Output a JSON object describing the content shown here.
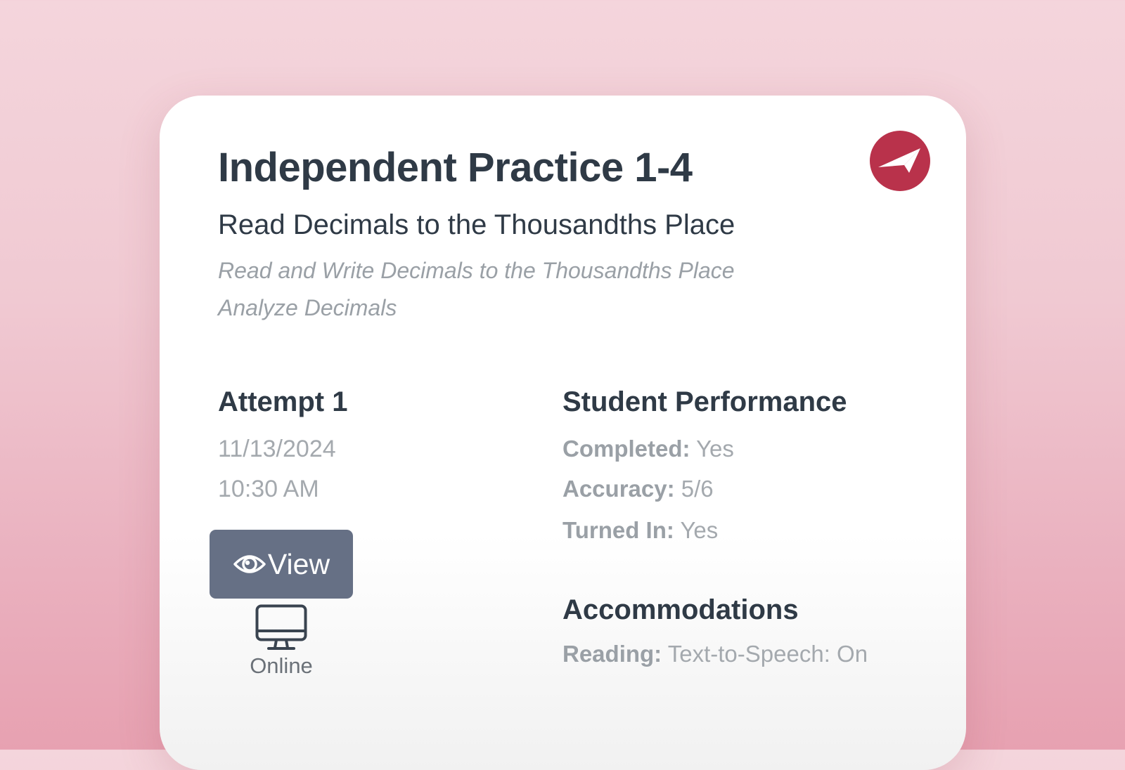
{
  "colors": {
    "background_top": "#f4d5dc",
    "background_bottom": "#e7a1b1",
    "card": "#ffffff",
    "heading_text": "#2f3a46",
    "muted_text": "#a4a9ae",
    "logo": "#b9324b",
    "button": "#667085"
  },
  "assignment": {
    "title": "Independent Practice 1-4",
    "lesson": "Read Decimals to the Thousandths Place",
    "standards": [
      "Read and Write Decimals to the Thousandths Place",
      "Analyze Decimals"
    ],
    "logo_icon": "paper-plane-icon"
  },
  "attempt": {
    "heading": "Attempt 1",
    "date": "11/13/2024",
    "time": "10:30 AM",
    "view_button": {
      "icon": "eye-icon",
      "label": "View"
    },
    "mode": {
      "icon": "monitor-icon",
      "label": "Online"
    }
  },
  "performance": {
    "heading": "Student Performance",
    "items": [
      {
        "label": "Completed:",
        "value": "Yes"
      },
      {
        "label": "Accuracy:",
        "value": "5/6"
      },
      {
        "label": "Turned In:",
        "value": "Yes"
      }
    ]
  },
  "accommodations": {
    "heading": "Accommodations",
    "items": [
      {
        "label": "Reading:",
        "value": "Text-to-Speech: On"
      }
    ]
  }
}
